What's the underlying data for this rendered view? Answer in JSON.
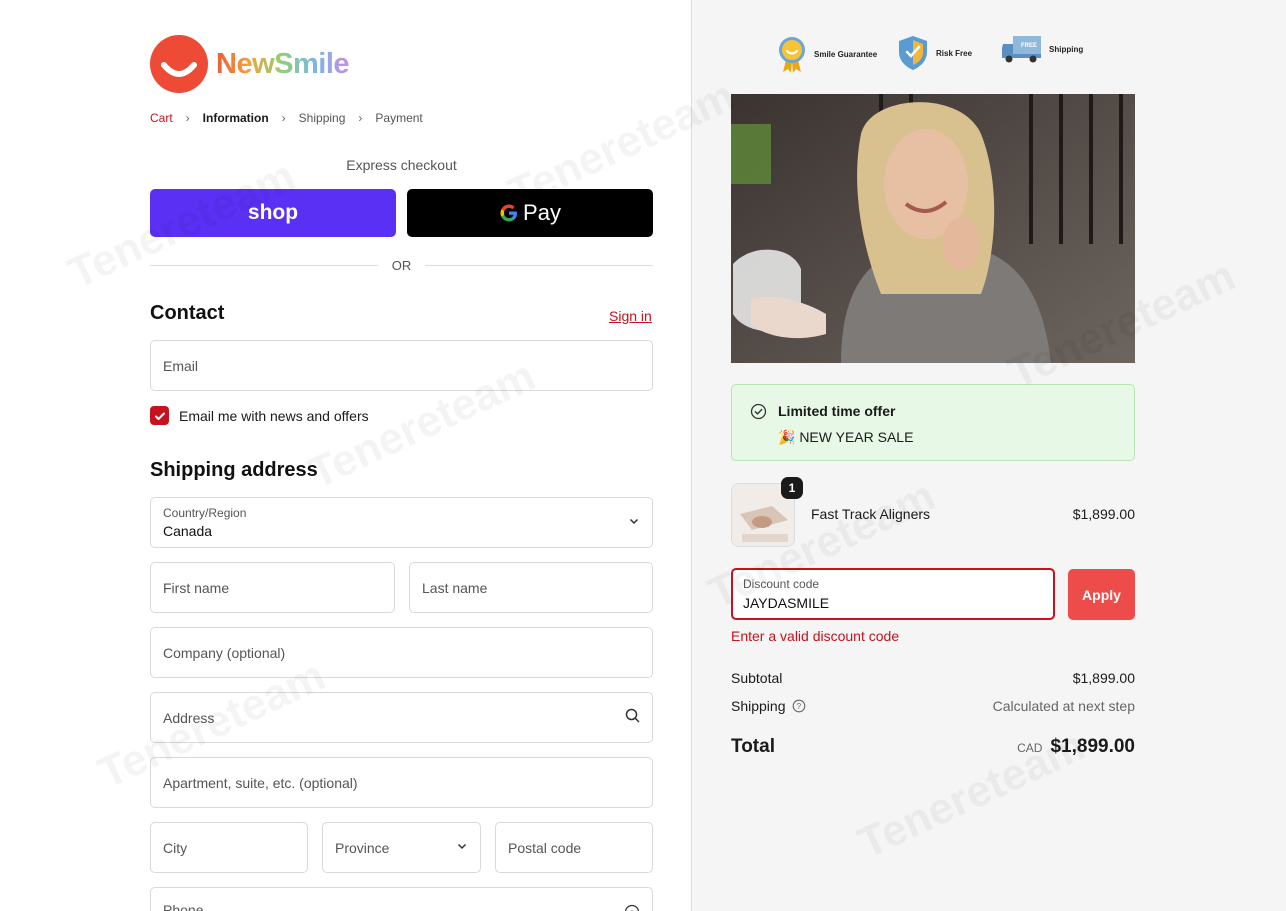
{
  "brand": {
    "name": "NewSmile"
  },
  "breadcrumb": {
    "cart": "Cart",
    "information": "Information",
    "shipping": "Shipping",
    "payment": "Payment"
  },
  "express": {
    "label": "Express checkout",
    "shop_label": "shop",
    "gpay_label": "Pay",
    "or": "OR"
  },
  "contact": {
    "title": "Contact",
    "signin": "Sign in",
    "email_placeholder": "Email",
    "newsletter_label": "Email me with news and offers",
    "newsletter_checked": true
  },
  "shipping_address": {
    "title": "Shipping address",
    "country_label": "Country/Region",
    "country_value": "Canada",
    "first_name": "First name",
    "last_name": "Last name",
    "company": "Company (optional)",
    "address": "Address",
    "apartment": "Apartment, suite, etc. (optional)",
    "city": "City",
    "province": "Province",
    "postal": "Postal code",
    "phone": "Phone"
  },
  "trust": [
    {
      "label": "Smile Guarantee",
      "icon": "medal-icon"
    },
    {
      "label": "Risk Free",
      "icon": "shield-check-icon"
    },
    {
      "label": "Shipping",
      "icon": "truck-icon"
    }
  ],
  "offer": {
    "title": "Limited time offer",
    "subtitle": "🎉 NEW YEAR SALE"
  },
  "product": {
    "name": "Fast Track Aligners",
    "price": "$1,899.00",
    "quantity": "1"
  },
  "discount": {
    "label": "Discount code",
    "value": "JAYDASMILE",
    "apply": "Apply",
    "error": "Enter a valid discount code"
  },
  "summary": {
    "subtotal_label": "Subtotal",
    "subtotal_value": "$1,899.00",
    "shipping_label": "Shipping",
    "shipping_value": "Calculated at next step",
    "total_label": "Total",
    "currency": "CAD",
    "total_value": "$1,899.00"
  },
  "watermark": "Tenereteam",
  "colors": {
    "accent": "#c5121e",
    "shop": "#5a31f4",
    "apply": "#ee4b4b",
    "offer_bg": "#e7f9e6"
  }
}
